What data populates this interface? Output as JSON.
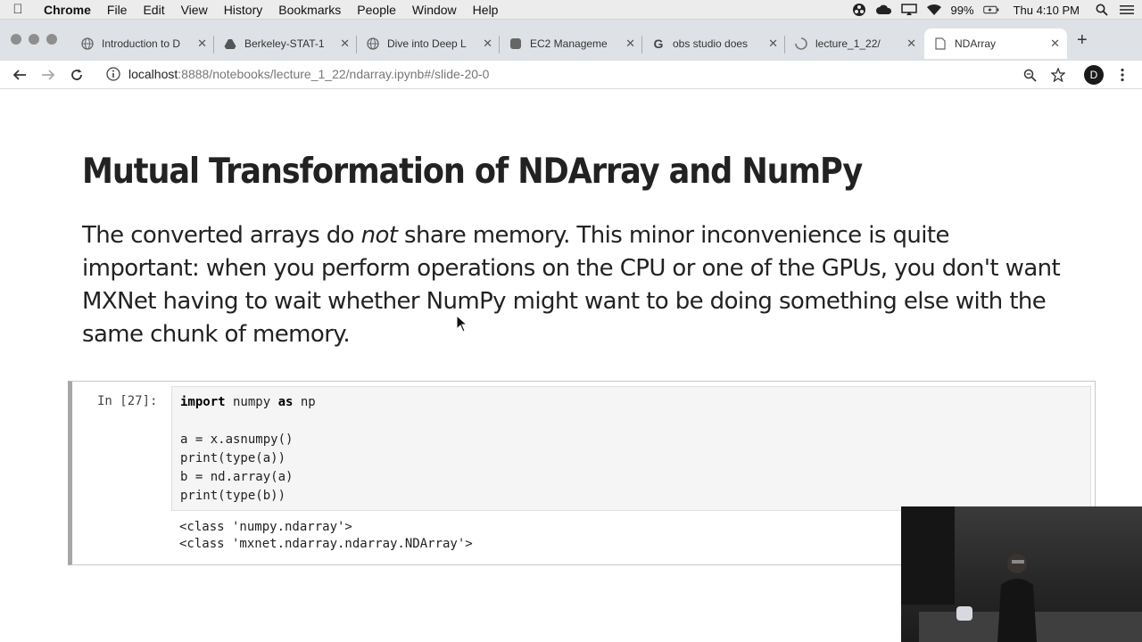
{
  "menubar": {
    "app": "Chrome",
    "items": [
      "File",
      "Edit",
      "View",
      "History",
      "Bookmarks",
      "People",
      "Window",
      "Help"
    ],
    "battery": "99%",
    "clock": "Thu 4:10 PM"
  },
  "tabs": [
    {
      "title": "Introduction to D",
      "icon": "globe-icon"
    },
    {
      "title": "Berkeley-STAT-1",
      "icon": "drive-icon"
    },
    {
      "title": "Dive into Deep L",
      "icon": "globe-icon"
    },
    {
      "title": "EC2 Manageme",
      "icon": "aws-icon"
    },
    {
      "title": "obs studio does",
      "icon": "google-icon"
    },
    {
      "title": "lecture_1_22/",
      "icon": "loading-icon"
    },
    {
      "title": "NDArray",
      "icon": "document-icon",
      "active": true
    }
  ],
  "toolbar": {
    "url_host": "localhost",
    "url_path": ":8888/notebooks/lecture_1_22/ndarray.ipynb#/slide-20-0",
    "profile_initial": "D"
  },
  "slide": {
    "title": "Mutual Transformation of NDArray and NumPy",
    "para_before": "The converted arrays do ",
    "para_emph": "not",
    "para_after": " share memory. This minor inconvenience is quite important: when you perform operations on the CPU or one of the GPUs, you don't want MXNet having to wait whether NumPy might want to be doing something else with the same chunk of memory."
  },
  "cell": {
    "prompt": "In [27]:",
    "code": {
      "line1_kw1": "import",
      "line1_mod": " numpy ",
      "line1_kw2": "as",
      "line1_alias": " np",
      "line2": "a = x.asnumpy()",
      "line3": "print(type(a))",
      "line4": "b = nd.array(a)",
      "line5": "print(type(b))"
    },
    "output": [
      "<class 'numpy.ndarray'>",
      "<class 'mxnet.ndarray.ndarray.NDArray'>"
    ]
  }
}
